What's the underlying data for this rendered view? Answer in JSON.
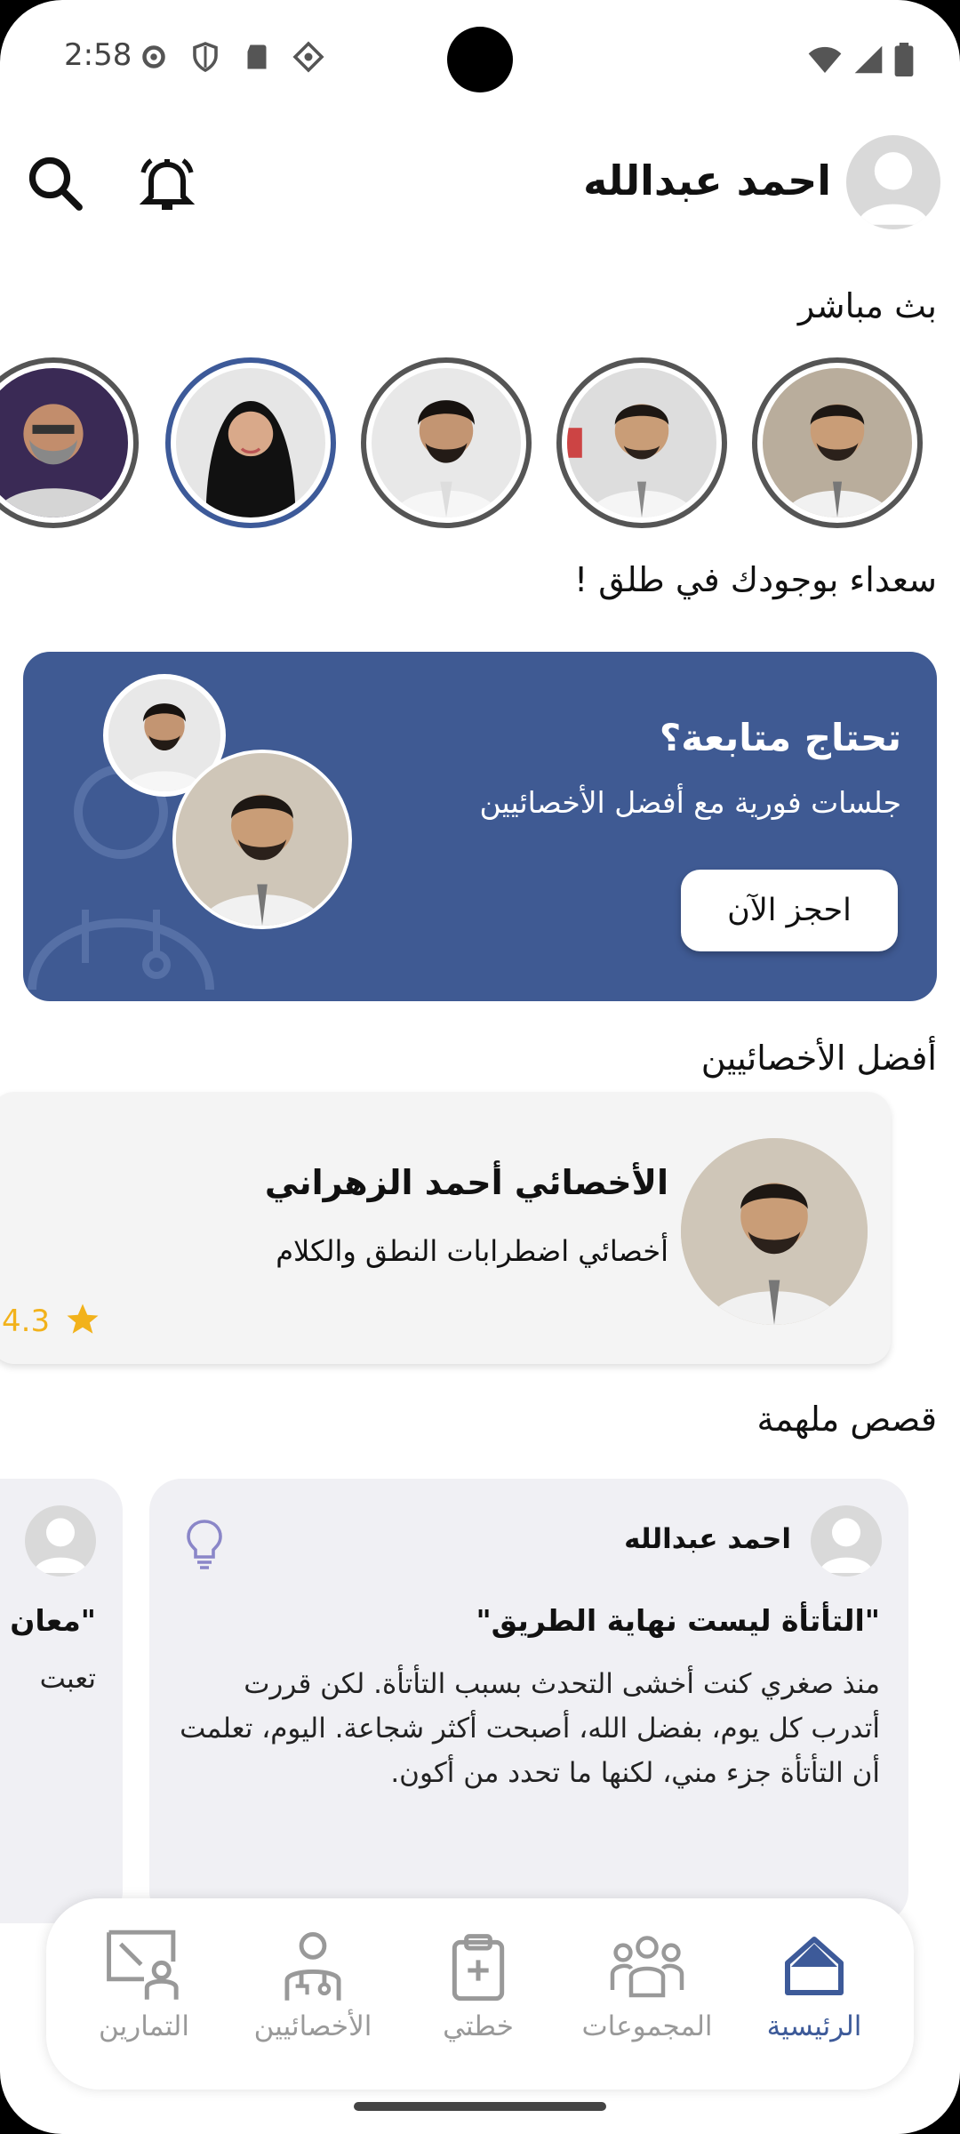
{
  "status_bar": {
    "time": "2:58"
  },
  "header": {
    "user_name": "احمد عبدالله"
  },
  "live": {
    "title": "بث مباشر"
  },
  "greeting": "سعداء بوجودك في طلق !",
  "banner": {
    "title": "تحتاج متابعة؟",
    "subtitle": "جلسات فورية مع أفضل الأخصائيين",
    "button": "احجز الآن"
  },
  "top_specialists": {
    "title": "أفضل الأخصائيين",
    "card": {
      "name": "الأخصائي أحمد الزهراني",
      "role": "أخصائي اضطرابات النطق والكلام",
      "rating": "4.3"
    }
  },
  "inspiring": {
    "title": "قصص ملهمة",
    "cards": [
      {
        "author": "احمد عبدالله",
        "title": "\"التأتأة ليست نهاية الطريق\"",
        "body": "منذ صغري كنت أخشى التحدث بسبب التأتأة. لكن قررت أتدرب كل يوم، بفضل الله، أصبحت أكثر شجاعة. اليوم، تعلمت أن التأتأة جزء مني، لكنها ما تحدد من أكون."
      },
      {
        "title": "\"معان",
        "body": "تعبت"
      }
    ]
  },
  "nav": {
    "home": "الرئيسية",
    "groups": "المجموعات",
    "plan": "خطتي",
    "specialists": "الأخصائيين",
    "exercises": "التمارين"
  },
  "colors": {
    "primary": "#3f5a93",
    "star": "#f2b21b",
    "inactive": "#999999"
  }
}
